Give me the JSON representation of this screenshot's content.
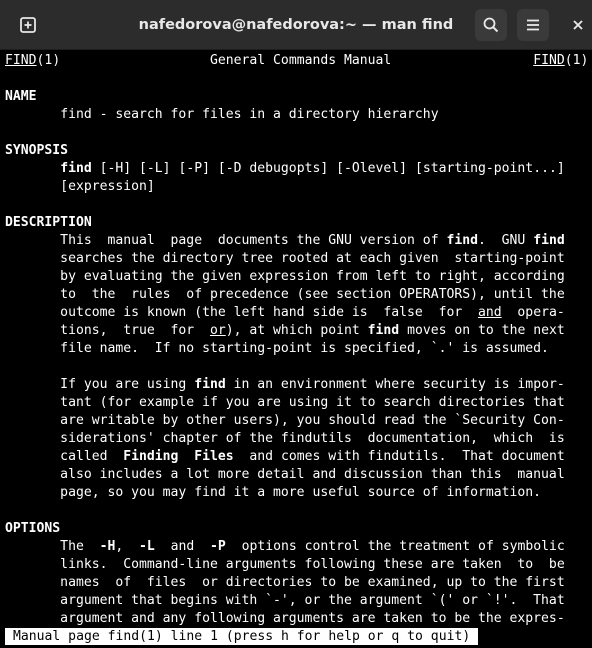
{
  "window": {
    "title": "nafedorova@nafedorova:~ — man find",
    "icons": {
      "new_tab": "new-tab-icon",
      "search": "search-icon",
      "menu": "hamburger-menu-icon",
      "close": "close-icon"
    }
  },
  "man": {
    "header": {
      "left_name": "FIND",
      "left_sec": "(1)",
      "center": "General Commands Manual",
      "right_name": "FIND",
      "right_sec": "(1)"
    },
    "name_heading": "NAME",
    "name_line": "find - search for files in a directory hierarchy",
    "synopsis_heading": "SYNOPSIS",
    "synopsis_cmd": "find",
    "synopsis_args": " [-H] [-L] [-P] [-D debugopts] [-Olevel] [starting-point...]",
    "synopsis_args2": "[expression]",
    "description_heading": "DESCRIPTION",
    "options_heading": "OPTIONS",
    "status": "Manual page find(1) line 1 (press h for help or q to quit)"
  },
  "colors": {
    "background": "#000000",
    "text": "#ffffff",
    "titlebar": "#2c2c2c",
    "button": "#3a3a3a"
  }
}
